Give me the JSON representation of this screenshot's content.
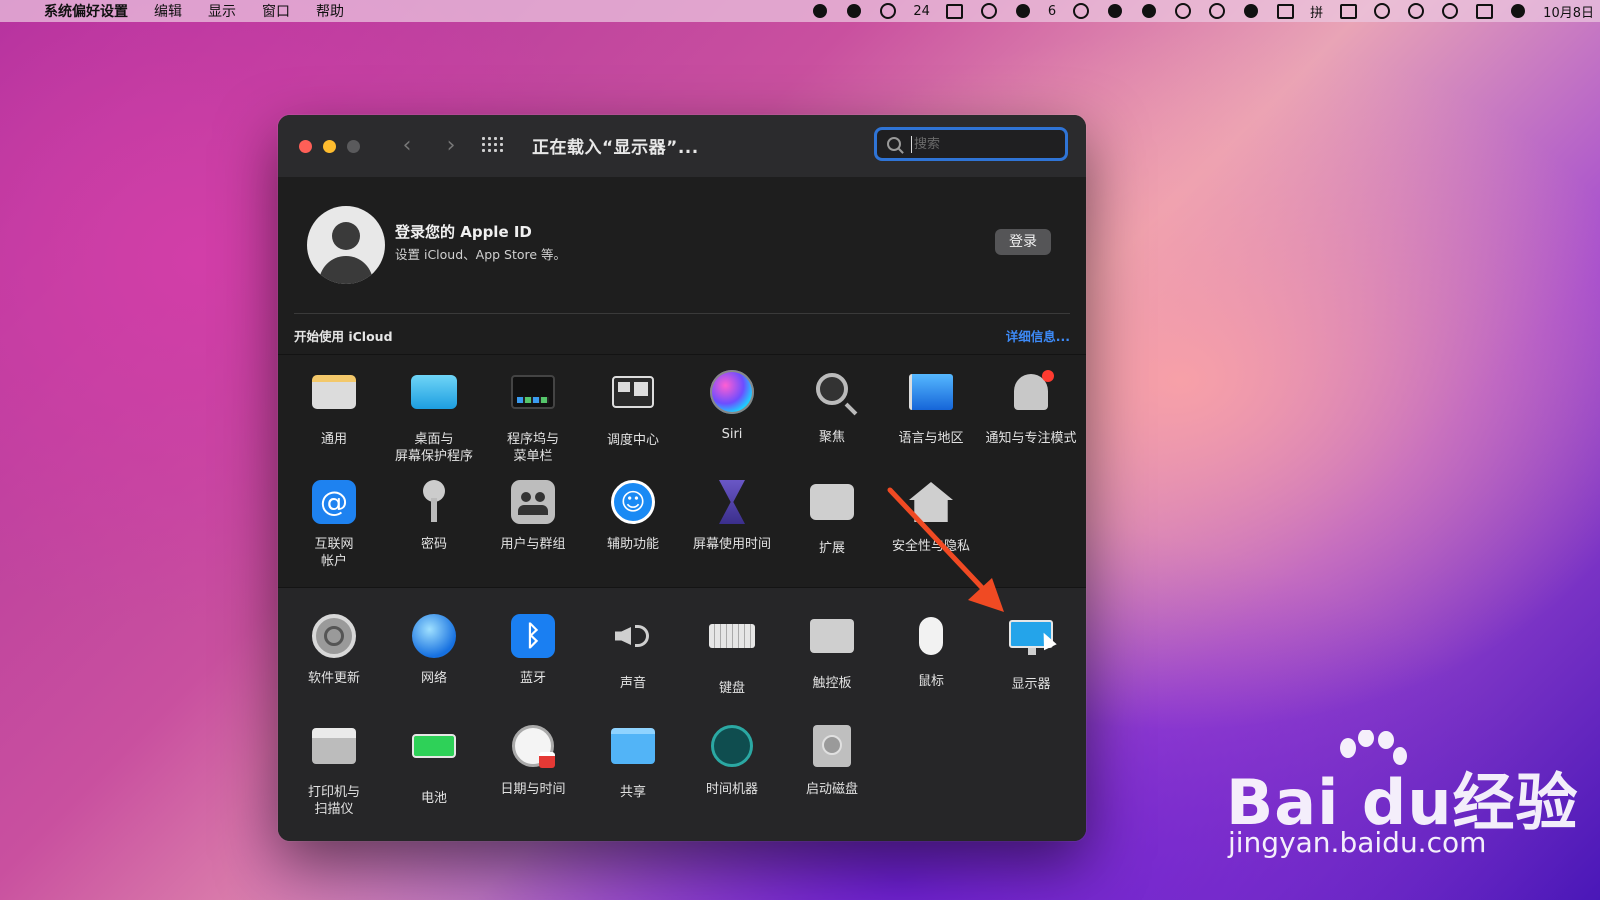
{
  "menubar": {
    "app_name": "系统偏好设置",
    "items": [
      "编辑",
      "显示",
      "窗口",
      "帮助"
    ],
    "status_icons": [
      "record-icon",
      "r-circle-icon",
      "wechat-icon",
      "keyboard-grid-icon",
      "face-icon",
      "bell-icon",
      "color-wheel-icon",
      "g-circle-icon",
      "bell-badge-icon",
      "cloud-group-icon",
      "fingerprint-icon",
      "pen-icon",
      "layers-icon",
      "input-method-icon",
      "battery-icon",
      "wifi-icon",
      "user-circle-icon",
      "search-icon",
      "control-center-icon",
      "siri-icon"
    ],
    "wechat_count": "24",
    "notif_count": "6",
    "input_method": "拼",
    "date": "10月8日"
  },
  "window": {
    "title": "正在载入“显示器”...",
    "search_placeholder": "搜索"
  },
  "apple_id": {
    "title": "登录您的 Apple ID",
    "subtitle": "设置 iCloud、App Store 等。",
    "login_label": "登录",
    "icloud_label": "开始使用 iCloud",
    "detail_link": "详细信息..."
  },
  "prefs": [
    {
      "label": "通用",
      "icon": "general-icon"
    },
    {
      "label": "桌面与\n屏幕保护程序",
      "icon": "desktop-icon"
    },
    {
      "label": "程序坞与\n菜单栏",
      "icon": "dock-icon"
    },
    {
      "label": "调度中心",
      "icon": "mission-control-icon"
    },
    {
      "label": "Siri",
      "icon": "siri-icon"
    },
    {
      "label": "聚焦",
      "icon": "spotlight-icon"
    },
    {
      "label": "语言与地区",
      "icon": "language-flag-icon"
    },
    {
      "label": "通知与专注模式",
      "icon": "notification-bell-icon"
    },
    {
      "label": "互联网\n帐户",
      "icon": "internet-accounts-icon"
    },
    {
      "label": "密码",
      "icon": "key-icon"
    },
    {
      "label": "用户与群组",
      "icon": "users-icon"
    },
    {
      "label": "辅助功能",
      "icon": "accessibility-icon"
    },
    {
      "label": "屏幕使用时间",
      "icon": "hourglass-icon"
    },
    {
      "label": "扩展",
      "icon": "puzzle-icon"
    },
    {
      "label": "安全性与隐私",
      "icon": "house-lock-icon"
    },
    {
      "label": "软件更新",
      "icon": "gear-update-icon"
    },
    {
      "label": "网络",
      "icon": "globe-icon"
    },
    {
      "label": "蓝牙",
      "icon": "bluetooth-icon"
    },
    {
      "label": "声音",
      "icon": "speaker-icon"
    },
    {
      "label": "键盘",
      "icon": "keyboard-icon"
    },
    {
      "label": "触控板",
      "icon": "trackpad-icon"
    },
    {
      "label": "鼠标",
      "icon": "mouse-icon"
    },
    {
      "label": "显示器",
      "icon": "display-icon"
    },
    {
      "label": "打印机与\n扫描仪",
      "icon": "printer-icon"
    },
    {
      "label": "电池",
      "icon": "battery-icon"
    },
    {
      "label": "日期与时间",
      "icon": "clock-icon"
    },
    {
      "label": "共享",
      "icon": "shared-folder-icon"
    },
    {
      "label": "时间机器",
      "icon": "time-machine-icon"
    },
    {
      "label": "启动磁盘",
      "icon": "startup-disk-icon"
    }
  ],
  "annotation": {
    "arrow_color": "#f04a23"
  },
  "watermark": {
    "brand": "Bai du经验",
    "url": "jingyan.baidu.com"
  },
  "colors": {
    "accent": "#2f74d6",
    "link": "#3d8af7",
    "close": "#ff5f57",
    "minimize": "#febc2e"
  }
}
